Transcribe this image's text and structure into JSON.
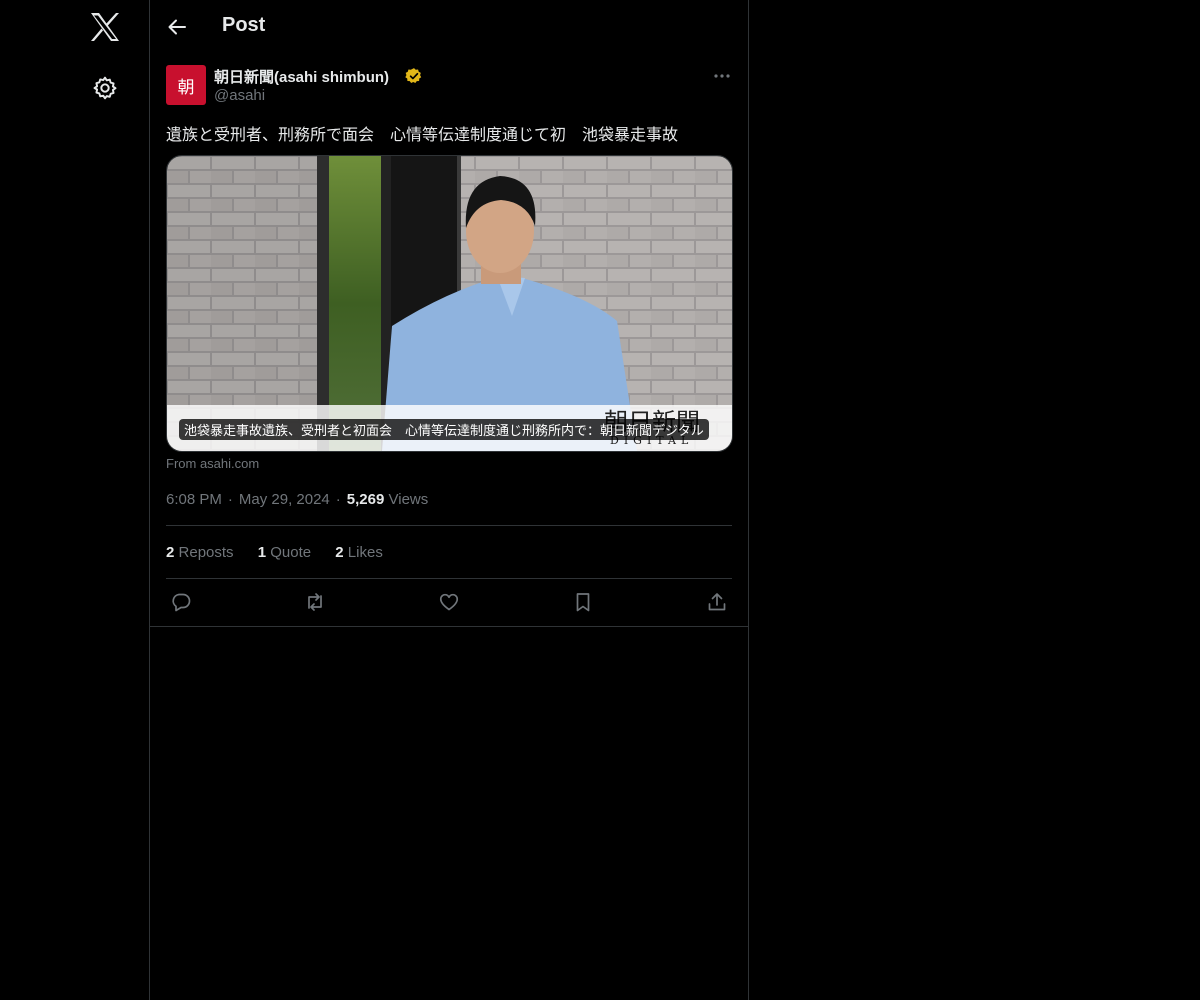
{
  "nav": {
    "logo_icon": "x-logo-icon",
    "settings_icon": "gear-icon"
  },
  "header": {
    "back_icon": "arrow-left-icon",
    "title": "Post"
  },
  "author": {
    "avatar_text": "朝",
    "avatar_color": "#c8102e",
    "display_name": "朝日新聞(asahi shimbun)",
    "verified_color": "#e2b719",
    "handle": "@asahi"
  },
  "post": {
    "text": "遺族と受刑者、刑務所で面会　心情等伝達制度通じて初　池袋暴走事故",
    "card": {
      "caption": "池袋暴走事故遺族、受刑者と初面会　心情等伝達制度通じ刑務所内で：朝日新聞デジタル",
      "watermark_title": "朝日新聞",
      "watermark_sub": "DIGITAL",
      "source": "From asahi.com"
    },
    "time": "6:08 PM",
    "date": "May 29, 2024",
    "views_count": "5,269",
    "views_label": "Views"
  },
  "stats": {
    "reposts_count": "2",
    "reposts_label": "Reposts",
    "quotes_count": "1",
    "quotes_label": "Quote",
    "likes_count": "2",
    "likes_label": "Likes"
  },
  "actions": [
    "reply-icon",
    "repost-icon",
    "like-icon",
    "bookmark-icon",
    "share-icon"
  ],
  "colors": {
    "background": "#000000",
    "text": "#e7e9ea",
    "muted": "#71767b",
    "border": "#2f3336"
  }
}
